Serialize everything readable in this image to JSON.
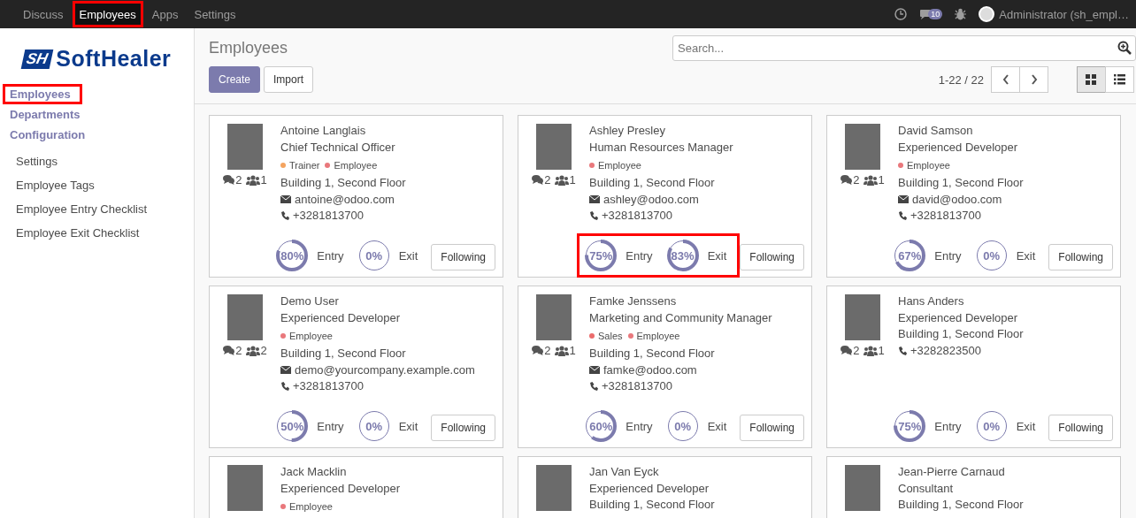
{
  "top_menu": [
    {
      "label": "Discuss",
      "selected": false,
      "highlighted": false
    },
    {
      "label": "Employees",
      "selected": true,
      "highlighted": true
    },
    {
      "label": "Apps",
      "selected": false,
      "highlighted": false
    },
    {
      "label": "Settings",
      "selected": false,
      "highlighted": false
    }
  ],
  "systray": {
    "messages_badge": "10",
    "user": "Administrator (sh_empl…"
  },
  "logo": {
    "mark": "SH",
    "name": "SoftHealer"
  },
  "sidebar": {
    "items": [
      {
        "label": "Employees",
        "highlighted": true
      },
      {
        "label": "Departments",
        "highlighted": false
      },
      {
        "label": "Configuration",
        "highlighted": false,
        "children": [
          {
            "label": "Settings"
          },
          {
            "label": "Employee Tags"
          },
          {
            "label": "Employee Entry Checklist"
          },
          {
            "label": "Employee Exit Checklist"
          }
        ]
      }
    ]
  },
  "control_panel": {
    "title": "Employees",
    "search": {
      "placeholder": "Search..."
    },
    "buttons": [
      {
        "label": "Create",
        "kind": "primary"
      },
      {
        "label": "Import",
        "kind": "secondary"
      }
    ],
    "pager": "1-22 / 22",
    "views": [
      {
        "kind": "kanban",
        "selected": true
      },
      {
        "kind": "list",
        "selected": false
      }
    ]
  },
  "cards": [
    {
      "name": "Antoine Langlais",
      "job": "Chief Technical Officer",
      "tags": [
        {
          "label": "Trainer",
          "color": "#f4a460"
        },
        {
          "label": "Employee",
          "color": "#e9787c"
        }
      ],
      "location": "Building 1, Second Floor",
      "email": "antoine@odoo.com",
      "phone": "+3281813700",
      "messages": "2",
      "followers": "1",
      "entry": {
        "reading": "80%",
        "level": 0.8,
        "label": "Entry"
      },
      "exit": {
        "reading": "0%",
        "level": 0,
        "label": "Exit"
      },
      "progress_highlighted": false,
      "follow_button": "Following"
    },
    {
      "name": "Ashley Presley",
      "job": "Human Resources Manager",
      "tags": [
        {
          "label": "Employee",
          "color": "#e9787c"
        }
      ],
      "location": "Building 1, Second Floor",
      "email": "ashley@odoo.com",
      "phone": "+3281813700",
      "messages": "2",
      "followers": "1",
      "entry": {
        "reading": "75%",
        "level": 0.75,
        "label": "Entry"
      },
      "exit": {
        "reading": "83%",
        "level": 0.83,
        "label": "Exit"
      },
      "progress_highlighted": true,
      "follow_button": "Following"
    },
    {
      "name": "David Samson",
      "job": "Experienced Developer",
      "tags": [
        {
          "label": "Employee",
          "color": "#e9787c"
        }
      ],
      "location": "Building 1, Second Floor",
      "email": "david@odoo.com",
      "phone": "+3281813700",
      "messages": "2",
      "followers": "1",
      "entry": {
        "reading": "67%",
        "level": 0.67,
        "label": "Entry"
      },
      "exit": {
        "reading": "0%",
        "level": 0,
        "label": "Exit"
      },
      "progress_highlighted": false,
      "follow_button": "Following"
    },
    {
      "name": "Demo User",
      "job": "Experienced Developer",
      "tags": [
        {
          "label": "Employee",
          "color": "#e9787c"
        }
      ],
      "location": "Building 1, Second Floor",
      "email": "demo@yourcompany.example.com",
      "phone": "+3281813700",
      "messages": "2",
      "followers": "2",
      "entry": {
        "reading": "50%",
        "level": 0.5,
        "label": "Entry"
      },
      "exit": {
        "reading": "0%",
        "level": 0,
        "label": "Exit"
      },
      "progress_highlighted": false,
      "follow_button": "Following"
    },
    {
      "name": "Famke Jenssens",
      "job": "Marketing and Community Manager",
      "tags": [
        {
          "label": "Sales",
          "color": "#eb6c6c"
        },
        {
          "label": "Employee",
          "color": "#e9787c"
        }
      ],
      "location": "Building 1, Second Floor",
      "email": "famke@odoo.com",
      "phone": "+3281813700",
      "messages": "2",
      "followers": "1",
      "entry": {
        "reading": "60%",
        "level": 0.6,
        "label": "Entry"
      },
      "exit": {
        "reading": "0%",
        "level": 0,
        "label": "Exit"
      },
      "progress_highlighted": false,
      "follow_button": "Following"
    },
    {
      "name": "Hans Anders",
      "job": "Experienced Developer",
      "location": "Building 1, Second Floor",
      "phone": "+3282823500",
      "messages": "2",
      "followers": "1",
      "entry": {
        "reading": "75%",
        "level": 0.75,
        "label": "Entry"
      },
      "exit": {
        "reading": "0%",
        "level": 0,
        "label": "Exit"
      },
      "progress_highlighted": false,
      "follow_button": "Following"
    },
    {
      "name": "Jack Macklin",
      "job": "Experienced Developer",
      "tags": [
        {
          "label": "Employee",
          "color": "#e9787c"
        }
      ]
    },
    {
      "name": "Jan Van Eyck",
      "job": "Experienced Developer",
      "location": "Building 1, Second Floor"
    },
    {
      "name": "Jean-Pierre Carnaud",
      "job": "Consultant",
      "location": "Building 1, Second Floor"
    }
  ]
}
